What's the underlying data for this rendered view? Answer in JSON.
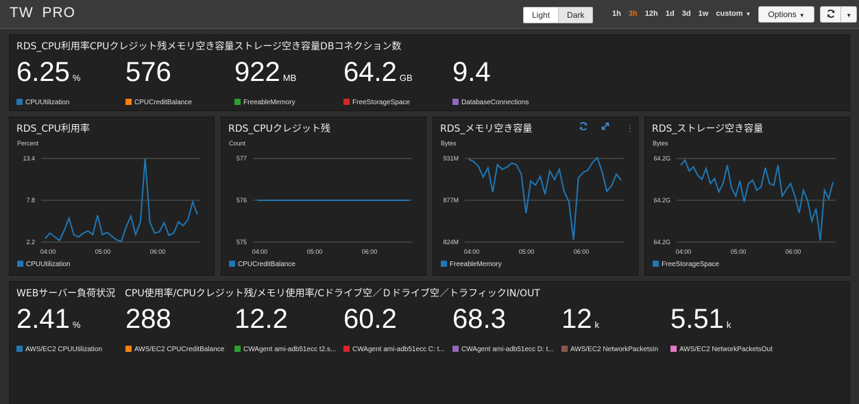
{
  "app": {
    "title": "TW  PRO"
  },
  "toolbar": {
    "theme_light": "Light",
    "theme_dark": "Dark",
    "ranges": [
      "1h",
      "3h",
      "12h",
      "1d",
      "3d",
      "1w",
      "custom"
    ],
    "active_range": "3h",
    "options_label": "Options",
    "refresh_icon": "refresh-icon"
  },
  "colors": {
    "blue": "#1f77b4",
    "orange": "#ff7f0e",
    "green": "#2ca02c",
    "red": "#d62728",
    "purple": "#9467bd",
    "brown": "#8c564b",
    "pink": "#e377c2",
    "accent": "#ec7211"
  },
  "rds_summary": {
    "title": "RDS_CPU利用率CPUクレジット残メモリ空き容量ストレージ空き容量DBコネクション数",
    "values": [
      {
        "value": "6.25",
        "unit": "%"
      },
      {
        "value": "576",
        "unit": ""
      },
      {
        "value": "922",
        "unit": "MB"
      },
      {
        "value": "64.2",
        "unit": "GB"
      },
      {
        "value": "9.4",
        "unit": ""
      }
    ],
    "legend": [
      "CPUUtilization",
      "CPUCreditBalance",
      "FreeableMemory",
      "FreeStorageSpace",
      "DatabaseConnections"
    ]
  },
  "web_summary": {
    "title": "WEBサーバー負荷状況　CPU使用率/CPUクレジット残/メモリ使用率/Cドライブ空／Ｄドライブ空／トラフィックIN/OUT",
    "values": [
      {
        "value": "2.41",
        "unit": "%"
      },
      {
        "value": "288",
        "unit": ""
      },
      {
        "value": "12.2",
        "unit": ""
      },
      {
        "value": "60.2",
        "unit": ""
      },
      {
        "value": "68.3",
        "unit": ""
      },
      {
        "value": "12",
        "unit": "k"
      },
      {
        "value": "5.51",
        "unit": "k"
      }
    ],
    "legend": [
      "AWS/EC2 CPUUtilization",
      "AWS/EC2 CPUCreditBalance",
      "CWAgent ami-adb51ecc t2.s...",
      "CWAgent ami-adb51ecc C: t...",
      "CWAgent ami-adb51ecc D: t...",
      "AWS/EC2 NetworkPacketsIn",
      "AWS/EC2 NetworkPacketsOut"
    ]
  },
  "chart_data": [
    {
      "type": "line",
      "title": "RDS_CPU利用率",
      "ylabel": "Percent",
      "yticks": [
        "13.4",
        "7.8",
        "2.2"
      ],
      "ylim": [
        2.2,
        13.4
      ],
      "xticks": [
        "04:00",
        "05:00",
        "06:00"
      ],
      "series": [
        {
          "name": "CPUUtilization",
          "values": [
            2.7,
            3.4,
            2.9,
            2.4,
            3.8,
            5.4,
            3.2,
            2.9,
            3.4,
            3.7,
            3.2,
            5.8,
            3.2,
            3.5,
            3.0,
            2.5,
            2.3,
            4.2,
            5.7,
            3.2,
            4.9,
            13.4,
            4.9,
            3.4,
            3.6,
            4.8,
            3.1,
            3.4,
            4.9,
            4.4,
            5.2,
            7.6,
            5.9
          ]
        }
      ]
    },
    {
      "type": "line",
      "title": "RDS_CPUクレジット残",
      "ylabel": "Count",
      "yticks": [
        "577",
        "576",
        "575"
      ],
      "ylim": [
        575,
        577
      ],
      "xticks": [
        "04:00",
        "05:00",
        "06:00"
      ],
      "series": [
        {
          "name": "CPUCreditBalance",
          "values": [
            576,
            576,
            576,
            576,
            576,
            576,
            576,
            576,
            576,
            576,
            576,
            576,
            576,
            576,
            576,
            576,
            576,
            576,
            576,
            576,
            576,
            576,
            576,
            576,
            576,
            576,
            576,
            576,
            576,
            576,
            576,
            576,
            576
          ]
        }
      ]
    },
    {
      "type": "line",
      "title": "RDS_メモリ空き容量",
      "ylabel": "Bytes",
      "yticks": [
        "931M",
        "877M",
        "824M"
      ],
      "ylim": [
        824,
        931
      ],
      "xticks": [
        "04:00",
        "05:00",
        "06:00"
      ],
      "series": [
        {
          "name": "FreeableMemory",
          "values": [
            930,
            927,
            921,
            907,
            919,
            888,
            923,
            917,
            920,
            925,
            923,
            911,
            861,
            902,
            897,
            908,
            885,
            915,
            904,
            917,
            889,
            876,
            827,
            906,
            913,
            916,
            926,
            932,
            914,
            889,
            896,
            911,
            903
          ]
        }
      ]
    },
    {
      "type": "line",
      "title": "RDS_ストレージ空き容量",
      "ylabel": "Bytes",
      "yticks": [
        "64.2G",
        "64.2G",
        "64.2G"
      ],
      "ylim": [
        0,
        1
      ],
      "xticks": [
        "04:00",
        "05:00",
        "06:00"
      ],
      "series": [
        {
          "name": "FreeStorageSpace",
          "values": [
            0.92,
            0.98,
            0.85,
            0.9,
            0.8,
            0.75,
            0.88,
            0.7,
            0.76,
            0.6,
            0.7,
            0.92,
            0.65,
            0.55,
            0.73,
            0.48,
            0.7,
            0.74,
            0.62,
            0.66,
            0.89,
            0.7,
            0.68,
            0.92,
            0.55,
            0.63,
            0.7,
            0.55,
            0.35,
            0.62,
            0.5,
            0.25,
            0.4,
            0.02,
            0.62,
            0.52,
            0.72
          ]
        }
      ]
    }
  ]
}
